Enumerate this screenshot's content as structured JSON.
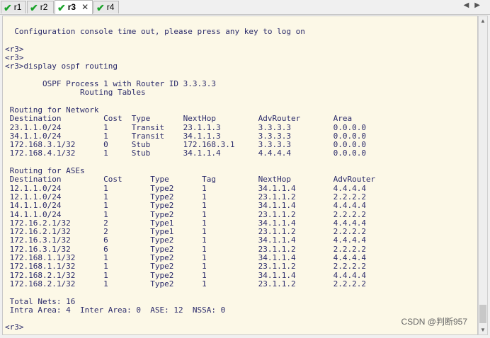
{
  "tabs": [
    {
      "label": "r1",
      "active": false
    },
    {
      "label": "r2",
      "active": false
    },
    {
      "label": "r3",
      "active": true
    },
    {
      "label": "r4",
      "active": false
    }
  ],
  "console_lines": [
    "",
    "  Configuration console time out, please press any key to log on",
    "",
    "<r3>",
    "<r3>",
    "<r3>display ospf routing",
    "",
    "        OSPF Process 1 with Router ID 3.3.3.3",
    "                Routing Tables",
    "",
    " Routing for Network",
    " Destination         Cost  Type       NextHop         AdvRouter       Area",
    " 23.1.1.0/24         1     Transit    23.1.1.3        3.3.3.3         0.0.0.0",
    " 34.1.1.0/24         1     Transit    34.1.1.3        3.3.3.3         0.0.0.0",
    " 172.168.3.1/32      0     Stub       172.168.3.1     3.3.3.3         0.0.0.0",
    " 172.168.4.1/32      1     Stub       34.1.1.4        4.4.4.4         0.0.0.0",
    "",
    " Routing for ASEs",
    " Destination         Cost      Type       Tag         NextHop         AdvRouter",
    " 12.1.1.0/24         1         Type2      1           34.1.1.4        4.4.4.4",
    " 12.1.1.0/24         1         Type2      1           23.1.1.2        2.2.2.2",
    " 14.1.1.0/24         1         Type2      1           34.1.1.4        4.4.4.4",
    " 14.1.1.0/24         1         Type2      1           23.1.1.2        2.2.2.2",
    " 172.16.2.1/32       2         Type1      1           34.1.1.4        4.4.4.4",
    " 172.16.2.1/32       2         Type1      1           23.1.1.2        2.2.2.2",
    " 172.16.3.1/32       6         Type2      1           34.1.1.4        4.4.4.4",
    " 172.16.3.1/32       6         Type2      1           23.1.1.2        2.2.2.2",
    " 172.168.1.1/32      1         Type2      1           34.1.1.4        4.4.4.4",
    " 172.168.1.1/32      1         Type2      1           23.1.1.2        2.2.2.2",
    " 172.168.2.1/32      1         Type2      1           34.1.1.4        4.4.4.4",
    " 172.168.2.1/32      1         Type2      1           23.1.1.2        2.2.2.2",
    "",
    " Total Nets: 16",
    " Intra Area: 4  Inter Area: 0  ASE: 12  NSSA: 0",
    "",
    "<r3>"
  ],
  "watermark": "CSDN @判断957",
  "icons": {
    "tab_ok": "check-icon",
    "tab_close": "close-icon",
    "nav_left": "arrow-left-icon",
    "nav_right": "arrow-right-icon"
  },
  "colors": {
    "console_bg": "#fcf8e7",
    "console_text": "#2a2a6a",
    "check": "#1aa32a"
  }
}
